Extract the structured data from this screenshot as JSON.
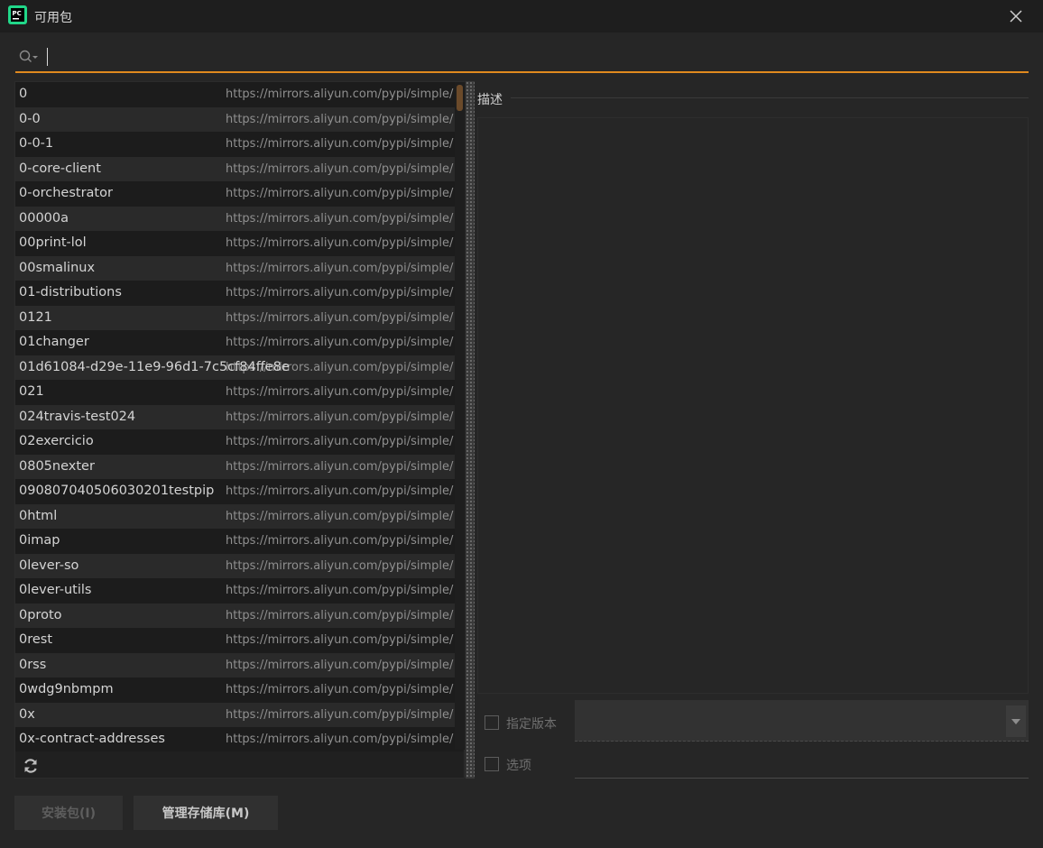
{
  "window": {
    "title": "可用包"
  },
  "search": {
    "value": "",
    "placeholder": ""
  },
  "packages": {
    "rows": [
      {
        "name": "0",
        "url": "https://mirrors.aliyun.com/pypi/simple/"
      },
      {
        "name": "0-0",
        "url": "https://mirrors.aliyun.com/pypi/simple/"
      },
      {
        "name": "0-0-1",
        "url": "https://mirrors.aliyun.com/pypi/simple/"
      },
      {
        "name": "0-core-client",
        "url": "https://mirrors.aliyun.com/pypi/simple/"
      },
      {
        "name": "0-orchestrator",
        "url": "https://mirrors.aliyun.com/pypi/simple/"
      },
      {
        "name": "00000a",
        "url": "https://mirrors.aliyun.com/pypi/simple/"
      },
      {
        "name": "00print-lol",
        "url": "https://mirrors.aliyun.com/pypi/simple/"
      },
      {
        "name": "00smalinux",
        "url": "https://mirrors.aliyun.com/pypi/simple/"
      },
      {
        "name": "01-distributions",
        "url": "https://mirrors.aliyun.com/pypi/simple/"
      },
      {
        "name": "0121",
        "url": "https://mirrors.aliyun.com/pypi/simple/"
      },
      {
        "name": "01changer",
        "url": "https://mirrors.aliyun.com/pypi/simple/"
      },
      {
        "name": "01d61084-d29e-11e9-96d1-7c5cf84ffe8e",
        "url": "https://mirrors.aliyun.com/pypi/simple/"
      },
      {
        "name": "021",
        "url": "https://mirrors.aliyun.com/pypi/simple/"
      },
      {
        "name": "024travis-test024",
        "url": "https://mirrors.aliyun.com/pypi/simple/"
      },
      {
        "name": "02exercicio",
        "url": "https://mirrors.aliyun.com/pypi/simple/"
      },
      {
        "name": "0805nexter",
        "url": "https://mirrors.aliyun.com/pypi/simple/"
      },
      {
        "name": "090807040506030201testpip",
        "url": "https://mirrors.aliyun.com/pypi/simple/"
      },
      {
        "name": "0html",
        "url": "https://mirrors.aliyun.com/pypi/simple/"
      },
      {
        "name": "0imap",
        "url": "https://mirrors.aliyun.com/pypi/simple/"
      },
      {
        "name": "0lever-so",
        "url": "https://mirrors.aliyun.com/pypi/simple/"
      },
      {
        "name": "0lever-utils",
        "url": "https://mirrors.aliyun.com/pypi/simple/"
      },
      {
        "name": "0proto",
        "url": "https://mirrors.aliyun.com/pypi/simple/"
      },
      {
        "name": "0rest",
        "url": "https://mirrors.aliyun.com/pypi/simple/"
      },
      {
        "name": "0rss",
        "url": "https://mirrors.aliyun.com/pypi/simple/"
      },
      {
        "name": "0wdg9nbmpm",
        "url": "https://mirrors.aliyun.com/pypi/simple/"
      },
      {
        "name": "0x",
        "url": "https://mirrors.aliyun.com/pypi/simple/"
      },
      {
        "name": "0x-contract-addresses",
        "url": "https://mirrors.aliyun.com/pypi/simple/"
      }
    ]
  },
  "details": {
    "description_label": "描述",
    "specify_version_label": "指定版本",
    "options_label": "选项"
  },
  "buttons": {
    "install": "安装包(I)",
    "manage_repos": "管理存储库(M)"
  },
  "colors": {
    "accent": "#e08a1e",
    "background": "#262626"
  }
}
